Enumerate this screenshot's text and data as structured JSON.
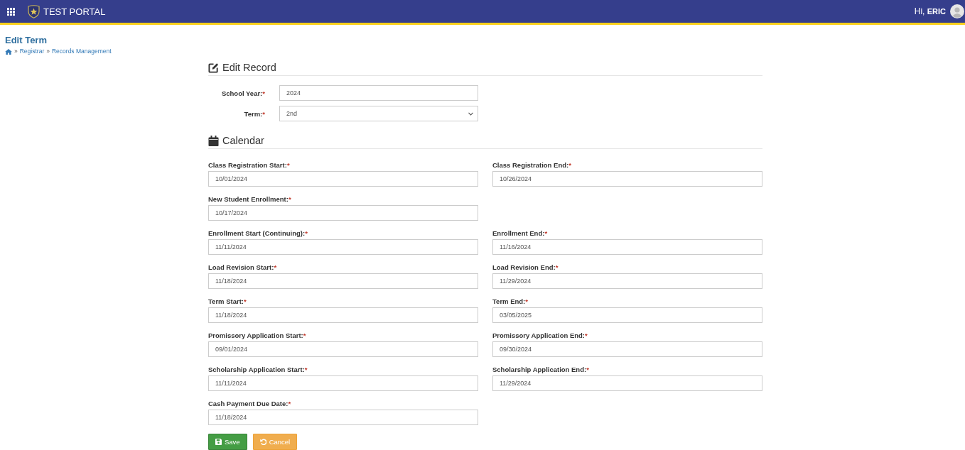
{
  "header": {
    "app_name": "TEST PORTAL",
    "greeting": "Hi, **ERIC**"
  },
  "page": {
    "title": "Edit Term",
    "breadcrumb": [
      {
        "separator": "»",
        "label": "Registrar"
      },
      {
        "separator": "»",
        "label": "Records Management"
      }
    ]
  },
  "edit_record": {
    "heading": "Edit Record",
    "fields": [
      {
        "kind": "text",
        "label": "School Year:",
        "required_mark": "*",
        "value": "2024"
      },
      {
        "kind": "select",
        "label": "Term:",
        "required_mark": "*",
        "value": "2nd"
      }
    ]
  },
  "calendar": {
    "heading": "Calendar",
    "rows": [
      {
        "fields": [
          {
            "label": "Class Registration Start:",
            "required_mark": "*",
            "value": "10/01/2024"
          },
          {
            "label": "Class Registration End:",
            "required_mark": "*",
            "value": "10/26/2024"
          }
        ]
      },
      {
        "fields": [
          {
            "label": "New Student Enrollment:",
            "required_mark": "*",
            "value": "10/17/2024"
          }
        ]
      },
      {
        "fields": [
          {
            "label": "Enrollment Start (Continuing):",
            "required_mark": "*",
            "value": "11/11/2024"
          },
          {
            "label": "Enrollment End:",
            "required_mark": "*",
            "value": "11/16/2024"
          }
        ]
      },
      {
        "fields": [
          {
            "label": "Load Revision Start:",
            "required_mark": "*",
            "value": "11/18/2024"
          },
          {
            "label": "Load Revision End:",
            "required_mark": "*",
            "value": "11/29/2024"
          }
        ]
      },
      {
        "fields": [
          {
            "label": "Term Start:",
            "required_mark": "*",
            "value": "11/18/2024"
          },
          {
            "label": "Term End:",
            "required_mark": "*",
            "value": "03/05/2025"
          }
        ]
      },
      {
        "fields": [
          {
            "label": "Promissory Application Start:",
            "required_mark": "*",
            "value": "09/01/2024"
          },
          {
            "label": "Promissory Application End:",
            "required_mark": "*",
            "value": "09/30/2024"
          }
        ]
      },
      {
        "fields": [
          {
            "label": "Scholarship Application Start:",
            "required_mark": "*",
            "value": "11/11/2024"
          },
          {
            "label": "Scholarship Application End:",
            "required_mark": "*",
            "value": "11/29/2024"
          }
        ]
      },
      {
        "fields": [
          {
            "label": "Cash Payment Due Date:",
            "required_mark": "*",
            "value": "11/18/2024"
          }
        ]
      }
    ]
  },
  "actions": [
    {
      "kind": "save",
      "label": "Save"
    },
    {
      "kind": "cancel",
      "label": "Cancel"
    }
  ]
}
